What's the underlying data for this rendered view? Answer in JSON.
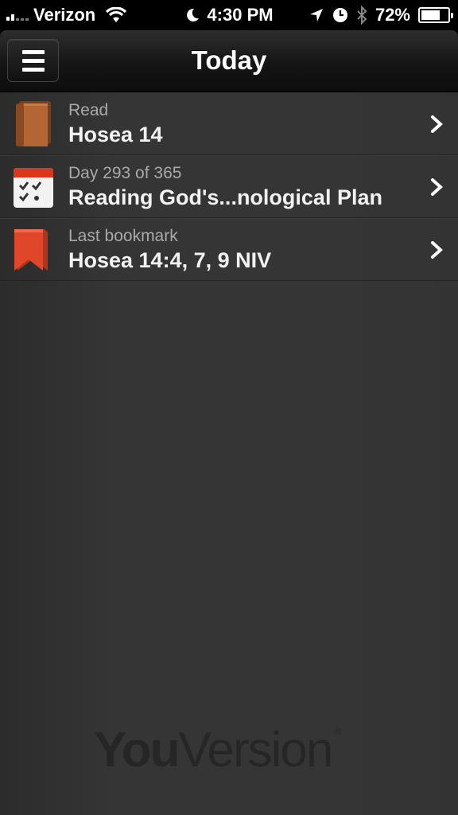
{
  "status_bar": {
    "carrier": "Verizon",
    "time": "4:30 PM",
    "battery": "72%",
    "battery_level": 0.72,
    "icons": [
      "signal-icon",
      "wifi-icon",
      "moon-icon",
      "location-icon",
      "clock-icon",
      "bluetooth-icon",
      "battery-icon"
    ]
  },
  "nav": {
    "title": "Today",
    "menu_icon": "hamburger-menu-icon"
  },
  "list": [
    {
      "icon": "book-icon",
      "sub": "Read",
      "main": "Hosea 14"
    },
    {
      "icon": "calendar-checklist-icon",
      "sub": "Day 293 of 365",
      "main": "Reading God's...nological Plan"
    },
    {
      "icon": "bookmark-icon",
      "sub": "Last bookmark",
      "main": "Hosea 14:4, 7, 9 NIV"
    }
  ],
  "footer": {
    "logo_part1": "You",
    "logo_part2": "Version",
    "logo_reg": "®"
  },
  "colors": {
    "background": "#353535",
    "nav_bar": "#151515",
    "book": "#a0582a",
    "calendar_red": "#d83a22",
    "bookmark": "#d84322"
  }
}
